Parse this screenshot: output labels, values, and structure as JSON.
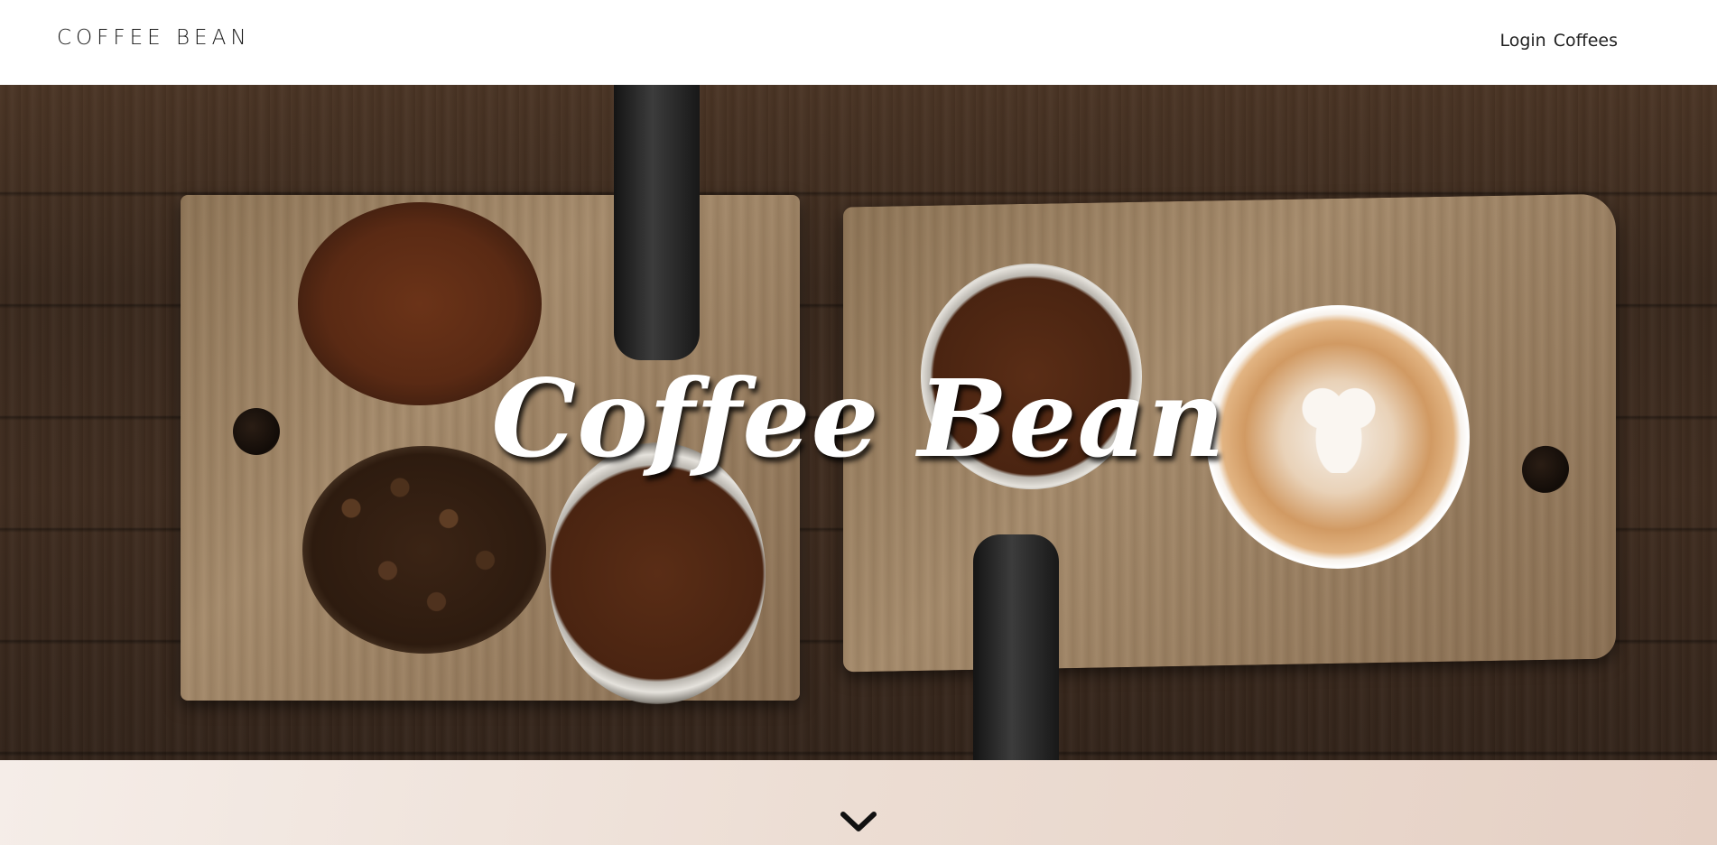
{
  "navbar": {
    "brand": "COFFEE BEAN",
    "links": [
      {
        "label": "Login"
      },
      {
        "label": "Coffees"
      }
    ]
  },
  "hero": {
    "title": "Coffee Bean"
  },
  "icons": {
    "scroll_down": "chevron-down-icon"
  },
  "colors": {
    "nav_background": "#ffffff",
    "hero_title": "#ffffff",
    "bottom_band": "#ecddd3",
    "chevron": "#111111"
  }
}
